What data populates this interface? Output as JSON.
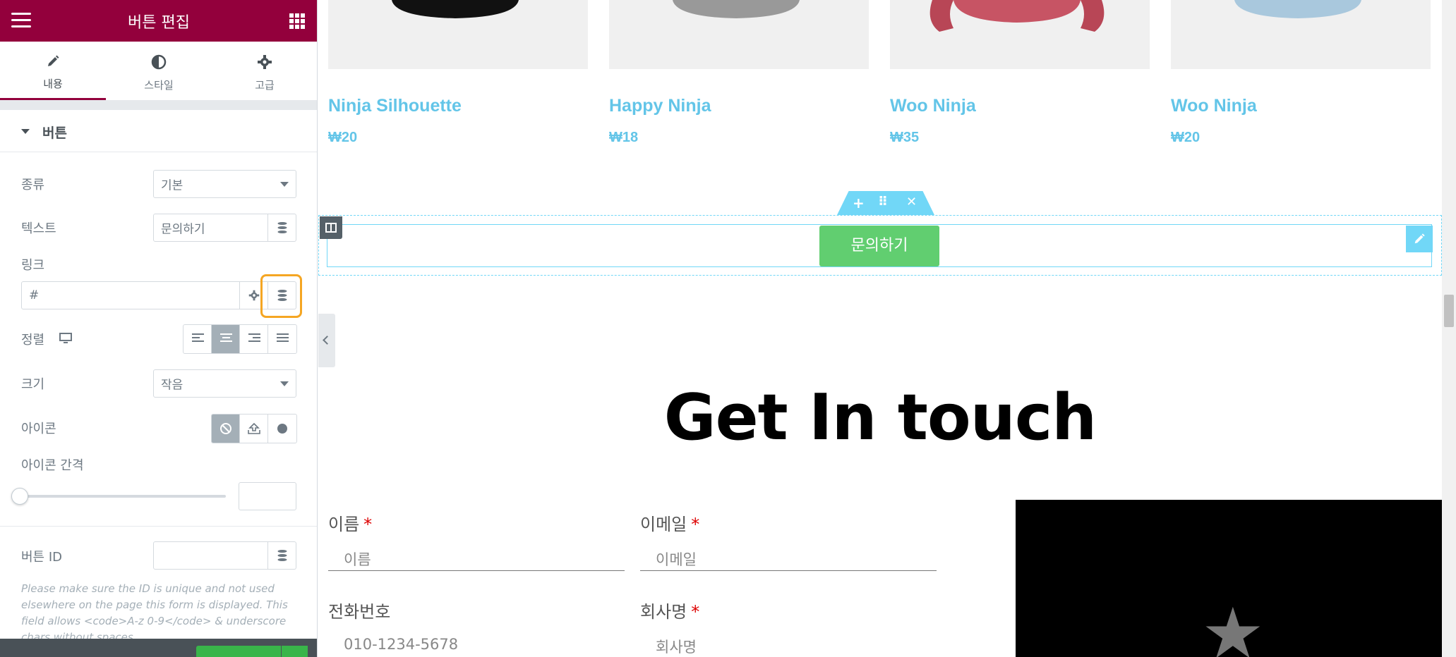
{
  "panel": {
    "title": "버튼 편집",
    "tabs": [
      {
        "label": "내용",
        "icon": "pencil-icon"
      },
      {
        "label": "스타일",
        "icon": "half-circle-icon"
      },
      {
        "label": "고급",
        "icon": "gear-icon"
      }
    ],
    "section_title": "버튼",
    "type": {
      "label": "종류",
      "value": "기본"
    },
    "text": {
      "label": "텍스트",
      "value": "문의하기"
    },
    "link": {
      "label": "링크",
      "value": "#"
    },
    "alignment": {
      "label": "정렬",
      "selected": "center"
    },
    "size": {
      "label": "크기",
      "value": "작음"
    },
    "icon": {
      "label": "아이콘",
      "options": [
        "none-icon",
        "upload-icon",
        "circle-icon"
      ],
      "selected": "none"
    },
    "icon_spacing": {
      "label": "아이콘 간격",
      "value": ""
    },
    "button_id": {
      "label": "버튼 ID",
      "value": ""
    },
    "hint": "Please make sure the ID is unique and not used elsewhere on the page this form is displayed. This field allows <code>A-z 0-9</code> & underscore chars without spaces."
  },
  "canvas": {
    "products": [
      {
        "title": "Ninja Silhouette",
        "price": "₩20"
      },
      {
        "title": "Happy Ninja",
        "price": "₩18"
      },
      {
        "title": "Woo Ninja",
        "price": "₩35"
      },
      {
        "title": "Woo Ninja",
        "price": "₩20"
      }
    ],
    "section_handle": {
      "add": "+",
      "move": "⠿",
      "close": "✕"
    },
    "button_label": "문의하기",
    "heading": "Get In touch",
    "form": {
      "name": {
        "label": "이름",
        "placeholder": "이름",
        "required": "*"
      },
      "email": {
        "label": "이메일",
        "placeholder": "이메일",
        "required": "*"
      },
      "phone": {
        "label": "전화번호",
        "placeholder": "010-1234-5678"
      },
      "company": {
        "label": "회사명",
        "placeholder": "회사명",
        "required": "*"
      }
    }
  },
  "colors": {
    "brand": "#93003c",
    "accent": "#71d7f7",
    "button": "#61ce70",
    "product_text": "#63c5e8"
  }
}
